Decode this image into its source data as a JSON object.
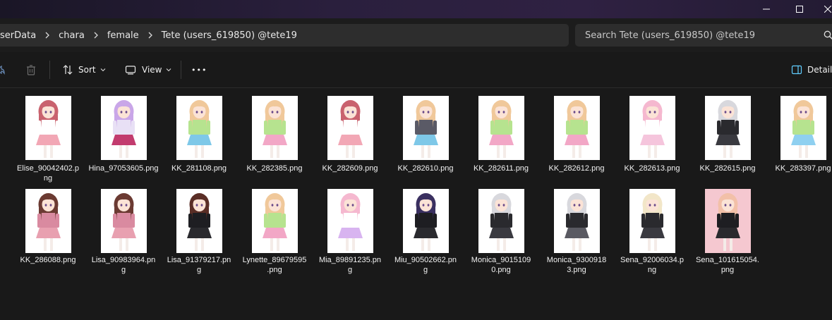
{
  "window": {
    "controls": [
      "minimize",
      "maximize",
      "close"
    ]
  },
  "breadcrumb": {
    "items": [
      "serData",
      "chara",
      "female",
      "Tete (users_619850) @tete19"
    ]
  },
  "search": {
    "placeholder": "Search Tete (users_619850) @tete19"
  },
  "toolbar": {
    "sort_label": "Sort",
    "view_label": "View",
    "more_label": "•••",
    "details_label": "Details"
  },
  "files": [
    {
      "name": "Elise_90042402.png",
      "line1": "Elise_90042402.p",
      "line2": "ng",
      "hair": "#c9626e",
      "outfit": "#ffffff",
      "skirt": "#f2a7b5",
      "bg": "#ffffff"
    },
    {
      "name": "Hina_97053605.png",
      "line1": "Hina_97053605.png",
      "line2": "",
      "hair": "#c9a6e8",
      "outfit": "#e8e0f5",
      "skirt": "#c23b6e",
      "bg": "#ffffff"
    },
    {
      "name": "KK_281108.png",
      "line1": "KK_281108.png",
      "line2": "",
      "hair": "#f0c89a",
      "outfit": "#b6e38f",
      "skirt": "#7ec8e8",
      "bg": "#ffffff"
    },
    {
      "name": "KK_282385.png",
      "line1": "KK_282385.png",
      "line2": "",
      "hair": "#f0c89a",
      "outfit": "#b6e38f",
      "skirt": "#f2a7c6",
      "bg": "#ffffff"
    },
    {
      "name": "KK_282609.png",
      "line1": "KK_282609.png",
      "line2": "",
      "hair": "#c9626e",
      "outfit": "#ffffff",
      "skirt": "#f2a7b5",
      "bg": "#ffffff"
    },
    {
      "name": "KK_282610.png",
      "line1": "KK_282610.png",
      "line2": "",
      "hair": "#f0c89a",
      "outfit": "#5a5a66",
      "skirt": "#7ec8e8",
      "bg": "#ffffff"
    },
    {
      "name": "KK_282611.png",
      "line1": "KK_282611.png",
      "line2": "",
      "hair": "#f0c89a",
      "outfit": "#b6e38f",
      "skirt": "#f2a7c6",
      "bg": "#ffffff"
    },
    {
      "name": "KK_282612.png",
      "line1": "KK_282612.png",
      "line2": "",
      "hair": "#f0c89a",
      "outfit": "#b6e38f",
      "skirt": "#f2a7c6",
      "bg": "#ffffff"
    },
    {
      "name": "KK_282613.png",
      "line1": "KK_282613.png",
      "line2": "",
      "hair": "#f5b8cf",
      "outfit": "#ffffff",
      "skirt": "#f5c5dc",
      "bg": "#ffffff"
    },
    {
      "name": "KK_282615.png",
      "line1": "KK_282615.png",
      "line2": "",
      "hair": "#d8d8dd",
      "outfit": "#2a2a2e",
      "skirt": "#3a3a40",
      "bg": "#ffffff"
    },
    {
      "name": "KK_283397.png",
      "line1": "KK_283397.png",
      "line2": "",
      "hair": "#f0c89a",
      "outfit": "#b6e38f",
      "skirt": "#8fd0f0",
      "bg": "#ffffff"
    },
    {
      "name": "KK_286088.png",
      "line1": "KK_286088.png",
      "line2": "",
      "hair": "#6b3a32",
      "outfit": "#d98aa0",
      "skirt": "#e8a0b0",
      "bg": "#ffffff"
    },
    {
      "name": "Lisa_90983964.png",
      "line1": "Lisa_90983964.pn",
      "line2": "g",
      "hair": "#6b3a32",
      "outfit": "#d98aa0",
      "skirt": "#e8a0b0",
      "bg": "#ffffff"
    },
    {
      "name": "Lisa_91379217.png",
      "line1": "Lisa_91379217.pn",
      "line2": "g",
      "hair": "#5a2e26",
      "outfit": "#1e1e22",
      "skirt": "#2a2a2e",
      "bg": "#ffffff"
    },
    {
      "name": "Lynette_89679595.png",
      "line1": "Lynette_89679595",
      "line2": ".png",
      "hair": "#f0c89a",
      "outfit": "#b6e38f",
      "skirt": "#f2a7c6",
      "bg": "#ffffff"
    },
    {
      "name": "Mia_89891235.png",
      "line1": "Mia_89891235.pn",
      "line2": "g",
      "hair": "#f5b8cf",
      "outfit": "#ffffff",
      "skirt": "#d8b4f0",
      "bg": "#ffffff"
    },
    {
      "name": "Miu_90502662.png",
      "line1": "Miu_90502662.pn",
      "line2": "g",
      "hair": "#3a3060",
      "outfit": "#1e1e22",
      "skirt": "#2a2a2e",
      "bg": "#ffffff"
    },
    {
      "name": "Monica_90151090.png",
      "line1": "Monica_9015109",
      "line2": "0.png",
      "hair": "#d8d8dd",
      "outfit": "#2a2a2e",
      "skirt": "#3a3a40",
      "bg": "#ffffff"
    },
    {
      "name": "Monica_93009183.png",
      "line1": "Monica_9300918",
      "line2": "3.png",
      "hair": "#d8d8dd",
      "outfit": "#2a2a2e",
      "skirt": "#5a5a62",
      "bg": "#ffffff"
    },
    {
      "name": "Sena_92006034.png",
      "line1": "Sena_92006034.p",
      "line2": "ng",
      "hair": "#f2e6c8",
      "outfit": "#2a2a2e",
      "skirt": "#3a3a40",
      "bg": "#ffffff"
    },
    {
      "name": "Sena_101615054.png",
      "line1": "Sena_101615054.",
      "line2": "png",
      "hair": "#f2c0a8",
      "outfit": "#1e1e22",
      "skirt": "#2a2a2e",
      "bg": "#f5c8d0"
    }
  ],
  "colors": {
    "background": "#191919",
    "addressbar": "#2d2d2d",
    "titlebar_accent": "#2f2142",
    "text": "#ffffff",
    "details_accent": "#60cdff"
  }
}
